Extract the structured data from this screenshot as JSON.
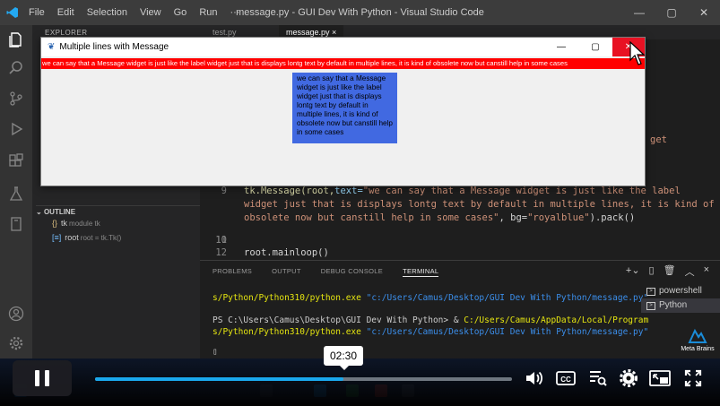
{
  "titlebar": {
    "menu": [
      "File",
      "Edit",
      "Selection",
      "View",
      "Go",
      "Run",
      "···"
    ],
    "title": "message.py - GUI Dev With Python - Visual Studio Code"
  },
  "sidebar": {
    "explorer_label": "EXPLORER",
    "outline_label": "OUTLINE",
    "outline_items": [
      {
        "name": "tk",
        "detail": "module tk"
      },
      {
        "name": "root",
        "detail": "root = tk.Tk()"
      }
    ]
  },
  "editor": {
    "tabs": [
      "test.py",
      "message.py"
    ],
    "code_lines": [
      {
        "num": "9",
        "text_fn": "tk.Message(root,",
        "param": "text=",
        "str": "\"we can say that a Message widget is just like the label"
      },
      {
        "num": "",
        "str": "widget just that is displays lontg text by default in multiple lines, it is kind of"
      },
      {
        "num": "",
        "str": "obsolete now but canstill help in some cases\"",
        "rest": ", bg=",
        "str2": "\"royalblue\"",
        "tail": ").pack()"
      },
      {
        "num": "10",
        "text": ""
      },
      {
        "num": "11",
        "text": ""
      },
      {
        "num": "12",
        "text": "root.mainloop()"
      }
    ],
    "right_fragment": "get"
  },
  "panel": {
    "tabs": [
      "PROBLEMS",
      "OUTPUT",
      "DEBUG CONSOLE",
      "TERMINAL"
    ],
    "terminal_lines": [
      {
        "yellow": "s/Python/Python310/python.exe",
        "blue": " \"c:/Users/Camus/Desktop/GUI Dev With Python/message.py\""
      },
      {
        "plain": "PS C:\\Users\\Camus\\Desktop\\GUI Dev With Python> & ",
        "yellow": "C:/Users/Camus/AppData/Local/Program"
      },
      {
        "yellow": "s/Python/Python310/python.exe",
        "blue": " \"c:/Users/Camus/Desktop/GUI Dev With Python/message.py\""
      }
    ],
    "shells": [
      "powershell",
      "Python"
    ]
  },
  "tkwindow": {
    "title": "Multiple lines with Message",
    "label_text": "we can say that a Message widget is just like the label widget just that is displays lontg text by default in multiple lines, it is kind of obsolete now but canstill help in some cases",
    "message_text": "we can say that a Message widget is just like the label widget just that is displays lontg text by default in multiple lines, it is kind of obsolete now but canstill help in some cases",
    "label_bg": "#ff0000",
    "message_bg": "#4169e1"
  },
  "video": {
    "time": "02:30",
    "progress": 0.595,
    "watermark": "Meta Brains"
  }
}
